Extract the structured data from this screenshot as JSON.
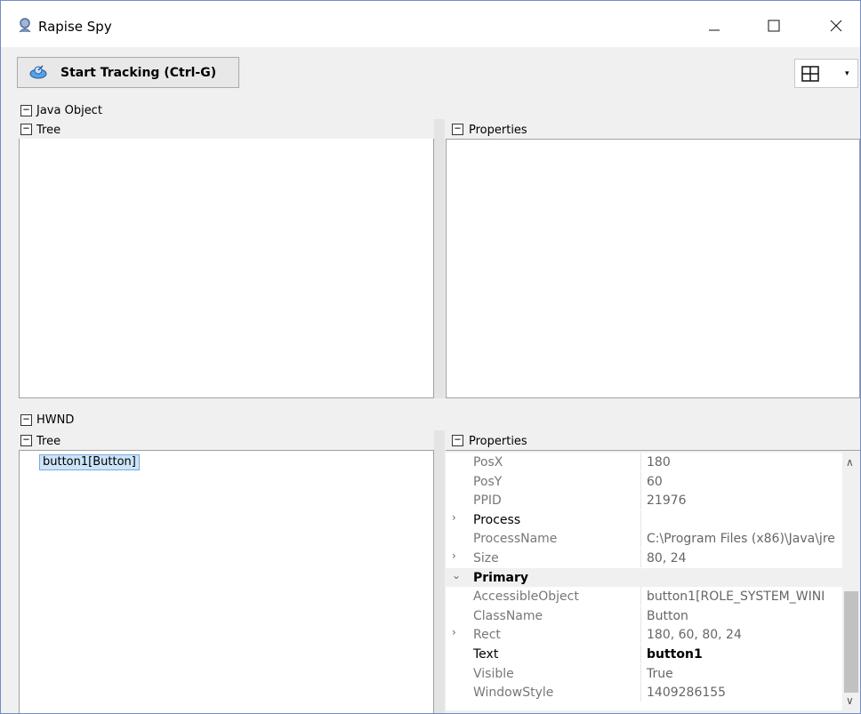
{
  "window": {
    "title": "Rapise Spy"
  },
  "toolbar": {
    "start_tracking_label": "Start Tracking (Ctrl-G)"
  },
  "java_section": {
    "label": "Java Object",
    "tree_label": "Tree",
    "properties_label": "Properties"
  },
  "hwnd_section": {
    "label": "HWND",
    "tree_label": "Tree",
    "properties_label": "Properties",
    "tree_items": [
      "button1[Button]"
    ]
  },
  "properties": [
    {
      "name": "PosX",
      "value": "180",
      "kind": "prop"
    },
    {
      "name": "PosY",
      "value": "60",
      "kind": "prop"
    },
    {
      "name": "PPID",
      "value": "21976",
      "kind": "prop"
    },
    {
      "name": "Process",
      "value": "",
      "kind": "expandable-strong"
    },
    {
      "name": "ProcessName",
      "value": "C:\\Program Files (x86)\\Java\\jre",
      "kind": "prop"
    },
    {
      "name": "Size",
      "value": "80, 24",
      "kind": "expandable"
    },
    {
      "name": "Primary",
      "value": "",
      "kind": "category"
    },
    {
      "name": "AccessibleObject",
      "value": "button1[ROLE_SYSTEM_WINI",
      "kind": "prop"
    },
    {
      "name": "ClassName",
      "value": "Button",
      "kind": "prop"
    },
    {
      "name": "Rect",
      "value": "180, 60, 80, 24",
      "kind": "expandable"
    },
    {
      "name": "Text",
      "value": "button1",
      "kind": "strong"
    },
    {
      "name": "Visible",
      "value": "True",
      "kind": "prop"
    },
    {
      "name": "WindowStyle",
      "value": "1409286155",
      "kind": "prop"
    }
  ],
  "icons": {
    "app": "search-person-icon",
    "tracking": "radar-icon",
    "layout": "grid-layout-icon"
  }
}
